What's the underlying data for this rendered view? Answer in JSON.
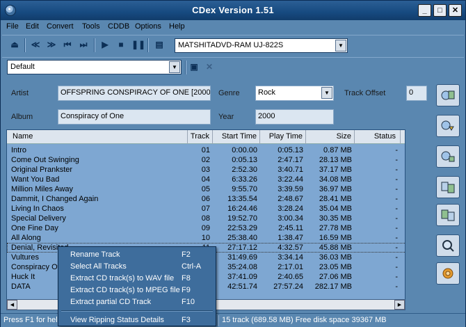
{
  "window": {
    "title": "CDex Version 1.51"
  },
  "titlebar_buttons": {
    "minimize": "_",
    "maximize": "□",
    "close": "✕"
  },
  "menu": [
    "File",
    "Edit",
    "Convert",
    "Tools",
    "CDDB",
    "Options",
    "Help"
  ],
  "drive": {
    "selected": "MATSHITADVD-RAM UJ-822S"
  },
  "profile": {
    "selected": "Default"
  },
  "fields": {
    "artist_label": "Artist",
    "artist": "OFFSPRING CONSPIRACY OF ONE [2000]",
    "genre_label": "Genre",
    "genre": "Rock",
    "track_offset_label": "Track Offset",
    "track_offset": "0",
    "album_label": "Album",
    "album": "Conspiracy of One",
    "year_label": "Year",
    "year": "2000"
  },
  "columns": [
    "Name",
    "Track",
    "Start Time",
    "Play Time",
    "Size",
    "Status"
  ],
  "tracks": [
    {
      "name": "Intro",
      "track": "01",
      "start": "0:00.00",
      "play": "0:05.13",
      "size": "0.87 MB",
      "status": "-"
    },
    {
      "name": "Come Out Swinging",
      "track": "02",
      "start": "0:05.13",
      "play": "2:47.17",
      "size": "28.13 MB",
      "status": "-"
    },
    {
      "name": "Original Prankster",
      "track": "03",
      "start": "2:52.30",
      "play": "3:40.71",
      "size": "37.17 MB",
      "status": "-"
    },
    {
      "name": "Want You Bad",
      "track": "04",
      "start": "6:33.26",
      "play": "3:22.44",
      "size": "34.08 MB",
      "status": "-"
    },
    {
      "name": "Million Miles Away",
      "track": "05",
      "start": "9:55.70",
      "play": "3:39.59",
      "size": "36.97 MB",
      "status": "-"
    },
    {
      "name": "Dammit, I Changed Again",
      "track": "06",
      "start": "13:35.54",
      "play": "2:48.67",
      "size": "28.41 MB",
      "status": "-"
    },
    {
      "name": "Living In Chaos",
      "track": "07",
      "start": "16:24.46",
      "play": "3:28.24",
      "size": "35.04 MB",
      "status": "-"
    },
    {
      "name": "Special Delivery",
      "track": "08",
      "start": "19:52.70",
      "play": "3:00.34",
      "size": "30.35 MB",
      "status": "-"
    },
    {
      "name": "One Fine Day",
      "track": "09",
      "start": "22:53.29",
      "play": "2:45.11",
      "size": "27.78 MB",
      "status": "-"
    },
    {
      "name": "All Along",
      "track": "10",
      "start": "25:38.40",
      "play": "1:38.47",
      "size": "16.59 MB",
      "status": "-"
    },
    {
      "name": "Denial, Revisited",
      "track": "11",
      "start": "27:17.12",
      "play": "4:32.57",
      "size": "45.88 MB",
      "status": "-"
    },
    {
      "name": "Vultures",
      "track": "12",
      "start": "31:49.69",
      "play": "3:34.14",
      "size": "36.03 MB",
      "status": "-"
    },
    {
      "name": "Conspiracy Of One",
      "track": "13",
      "start": "35:24.08",
      "play": "2:17.01",
      "size": "23.05 MB",
      "status": "-"
    },
    {
      "name": "Huck It",
      "track": "14",
      "start": "37:41.09",
      "play": "2:40.65",
      "size": "27.06 MB",
      "status": "-"
    },
    {
      "name": "DATA",
      "track": "15",
      "start": "42:51.74",
      "play": "27:57.24",
      "size": "282.17 MB",
      "status": "-"
    }
  ],
  "context_menu": [
    {
      "label": "Rename Track",
      "key": "F2"
    },
    {
      "label": "Select All Tracks",
      "key": "Ctrl-A"
    },
    {
      "label": "Extract CD track(s) to WAV file",
      "key": "F8"
    },
    {
      "label": "Extract CD track(s) to MPEG file",
      "key": "F9"
    },
    {
      "label": "Extract partial CD Track",
      "key": "F10"
    },
    {
      "label": "View Ripping Status Details",
      "key": "F3"
    }
  ],
  "status": {
    "left": "Press F1 for help",
    "right": "15 track (689.58 MB) Free disk space 39367 MB"
  },
  "colors": {
    "window": "#5a87b0",
    "list": "#7ea7d2",
    "menu": "#3e6d9c",
    "titlebar": "#174a80"
  }
}
